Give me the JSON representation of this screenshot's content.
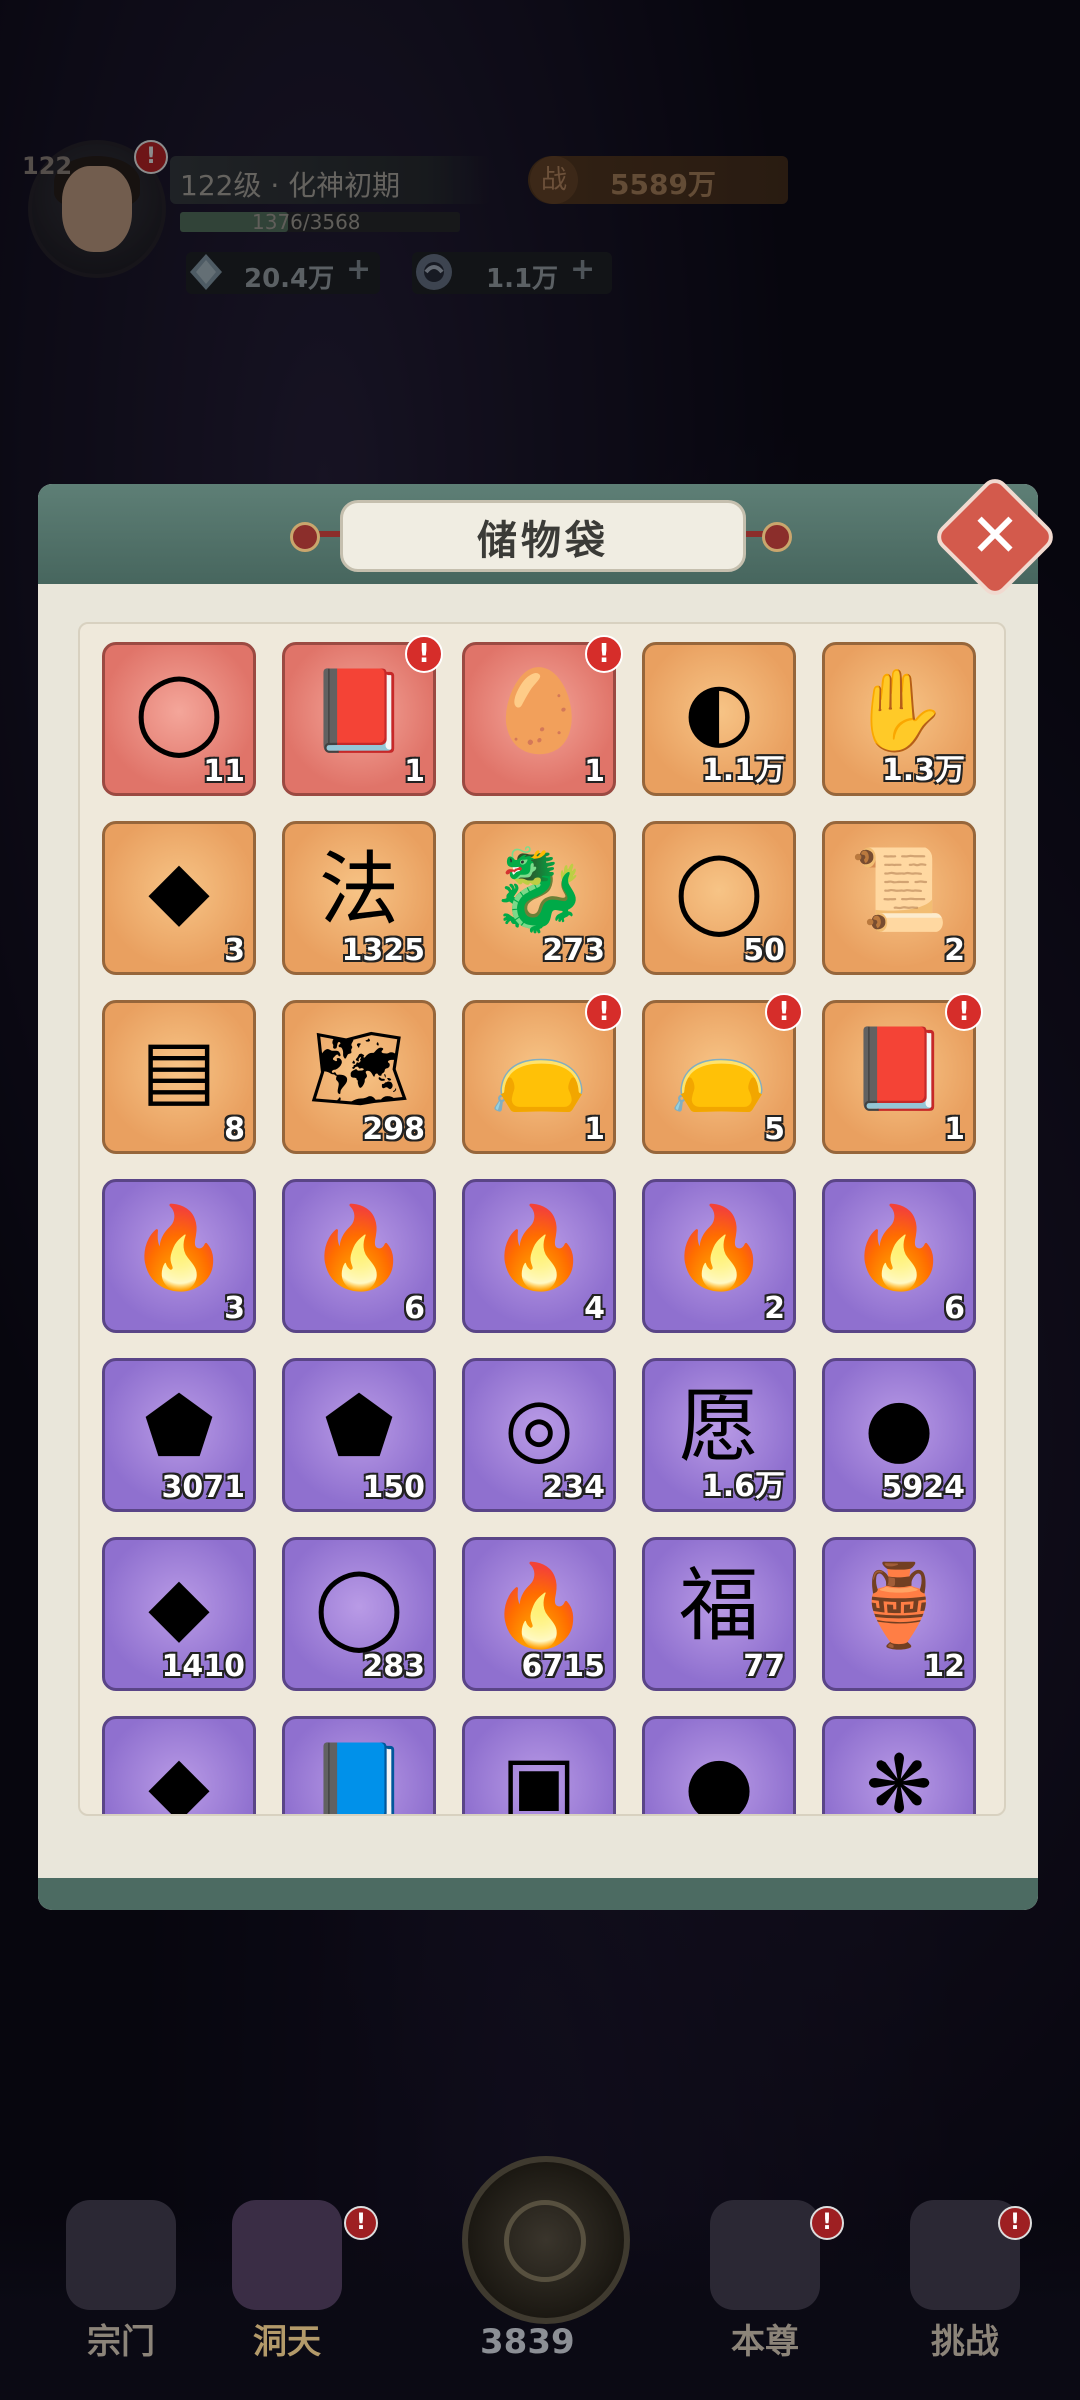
{
  "hud": {
    "level_corner": "122",
    "realm": "122级 · 化神初期",
    "exp": "1376/3568",
    "exp_fraction": 0.386,
    "power_icon": "战",
    "power": "5589万",
    "crystals": "20.4万",
    "coins": "1.1万",
    "plus": "+"
  },
  "panel": {
    "title": "储物袋",
    "close_glyph": "✕"
  },
  "items": [
    {
      "tier": "red",
      "icon": "jade-ring-icon",
      "glyph": "◯",
      "count": "11",
      "alert": false
    },
    {
      "tier": "red",
      "icon": "selection-book-icon",
      "glyph": "📕",
      "count": "1",
      "alert": true
    },
    {
      "tier": "red",
      "icon": "selection-egg-icon",
      "glyph": "🥚",
      "count": "1",
      "alert": true
    },
    {
      "tier": "orange",
      "icon": "cloud-orb-icon",
      "glyph": "◐",
      "count": "1.1万",
      "alert": false
    },
    {
      "tier": "orange",
      "icon": "beast-claw-icon",
      "glyph": "✋",
      "count": "1.3万",
      "alert": false
    },
    {
      "tier": "orange",
      "icon": "crystal-tile-icon",
      "glyph": "◆",
      "count": "3",
      "alert": false
    },
    {
      "tier": "orange",
      "icon": "dharma-token-icon",
      "glyph": "法",
      "count": "1325",
      "alert": false
    },
    {
      "tier": "orange",
      "icon": "jade-lion-icon",
      "glyph": "🐉",
      "count": "273",
      "alert": false
    },
    {
      "tier": "orange",
      "icon": "golden-bracelet-icon",
      "glyph": "◯",
      "count": "50",
      "alert": false
    },
    {
      "tier": "orange",
      "icon": "ancient-scroll-icon",
      "glyph": "📜",
      "count": "2",
      "alert": false
    },
    {
      "tier": "orange",
      "icon": "talisman-papers-icon",
      "glyph": "▤",
      "count": "8",
      "alert": false
    },
    {
      "tier": "orange",
      "icon": "map-scroll-icon",
      "glyph": "🗺",
      "count": "298",
      "alert": false
    },
    {
      "tier": "orange",
      "icon": "mystery-bag-icon",
      "glyph": "👝",
      "count": "1",
      "alert": true
    },
    {
      "tier": "orange",
      "icon": "fire-bag-icon",
      "glyph": "👝",
      "count": "5",
      "alert": true
    },
    {
      "tier": "orange",
      "icon": "selection-book-icon",
      "glyph": "📕",
      "count": "1",
      "alert": true
    },
    {
      "tier": "purple",
      "icon": "yellow-flame-icon",
      "glyph": "🔥",
      "count": "3",
      "alert": false
    },
    {
      "tier": "purple",
      "icon": "green-flame-icon",
      "glyph": "🔥",
      "count": "6",
      "alert": false
    },
    {
      "tier": "purple",
      "icon": "blue-flame-icon",
      "glyph": "🔥",
      "count": "4",
      "alert": false
    },
    {
      "tier": "purple",
      "icon": "red-flame-icon",
      "glyph": "🔥",
      "count": "2",
      "alert": false
    },
    {
      "tier": "purple",
      "icon": "dark-flame-icon",
      "glyph": "🔥",
      "count": "6",
      "alert": false
    },
    {
      "tier": "purple",
      "icon": "iron-ore-icon",
      "glyph": "⬟",
      "count": "3071",
      "alert": false
    },
    {
      "tier": "purple",
      "icon": "gold-ore-icon",
      "glyph": "⬟",
      "count": "150",
      "alert": false
    },
    {
      "tier": "purple",
      "icon": "compass-icon",
      "glyph": "◎",
      "count": "234",
      "alert": false
    },
    {
      "tier": "purple",
      "icon": "wish-pouch-icon",
      "glyph": "愿",
      "count": "1.6万",
      "alert": false
    },
    {
      "tier": "purple",
      "icon": "spirit-orb-icon",
      "glyph": "●",
      "count": "5924",
      "alert": false
    },
    {
      "tier": "purple",
      "icon": "gold-crystal-icon",
      "glyph": "◆",
      "count": "1410",
      "alert": false
    },
    {
      "tier": "purple",
      "icon": "jade-bracelet-icon",
      "glyph": "◯",
      "count": "283",
      "alert": false
    },
    {
      "tier": "purple",
      "icon": "fire-seed-icon",
      "glyph": "🔥",
      "count": "6715",
      "alert": false
    },
    {
      "tier": "purple",
      "icon": "fortune-card-icon",
      "glyph": "福",
      "count": "77",
      "alert": false
    },
    {
      "tier": "purple",
      "icon": "jade-vase-icon",
      "glyph": "🏺",
      "count": "12",
      "alert": false
    },
    {
      "tier": "purple",
      "icon": "silver-shard-icon",
      "glyph": "◆",
      "count": "",
      "alert": false
    },
    {
      "tier": "purple",
      "icon": "purple-book-icon",
      "glyph": "📘",
      "count": "",
      "alert": false
    },
    {
      "tier": "purple",
      "icon": "gold-plaque-icon",
      "glyph": "▣",
      "count": "",
      "alert": false
    },
    {
      "tier": "purple",
      "icon": "pink-orb-icon",
      "glyph": "●",
      "count": "",
      "alert": false
    },
    {
      "tier": "purple",
      "icon": "spirit-wing-icon",
      "glyph": "❋",
      "count": "",
      "alert": false
    }
  ],
  "nav": {
    "sect": "宗门",
    "cave": "洞天",
    "center_count": "3839",
    "self": "本尊",
    "challenge": "挑战",
    "alert": "!"
  },
  "colors": {
    "panel_bg": "#e9e6da",
    "panel_header": "#5e7f76",
    "tier_red": "#e07469",
    "tier_orange": "#e9a060",
    "tier_purple": "#8f70cf",
    "close_red": "#d35a4c"
  }
}
